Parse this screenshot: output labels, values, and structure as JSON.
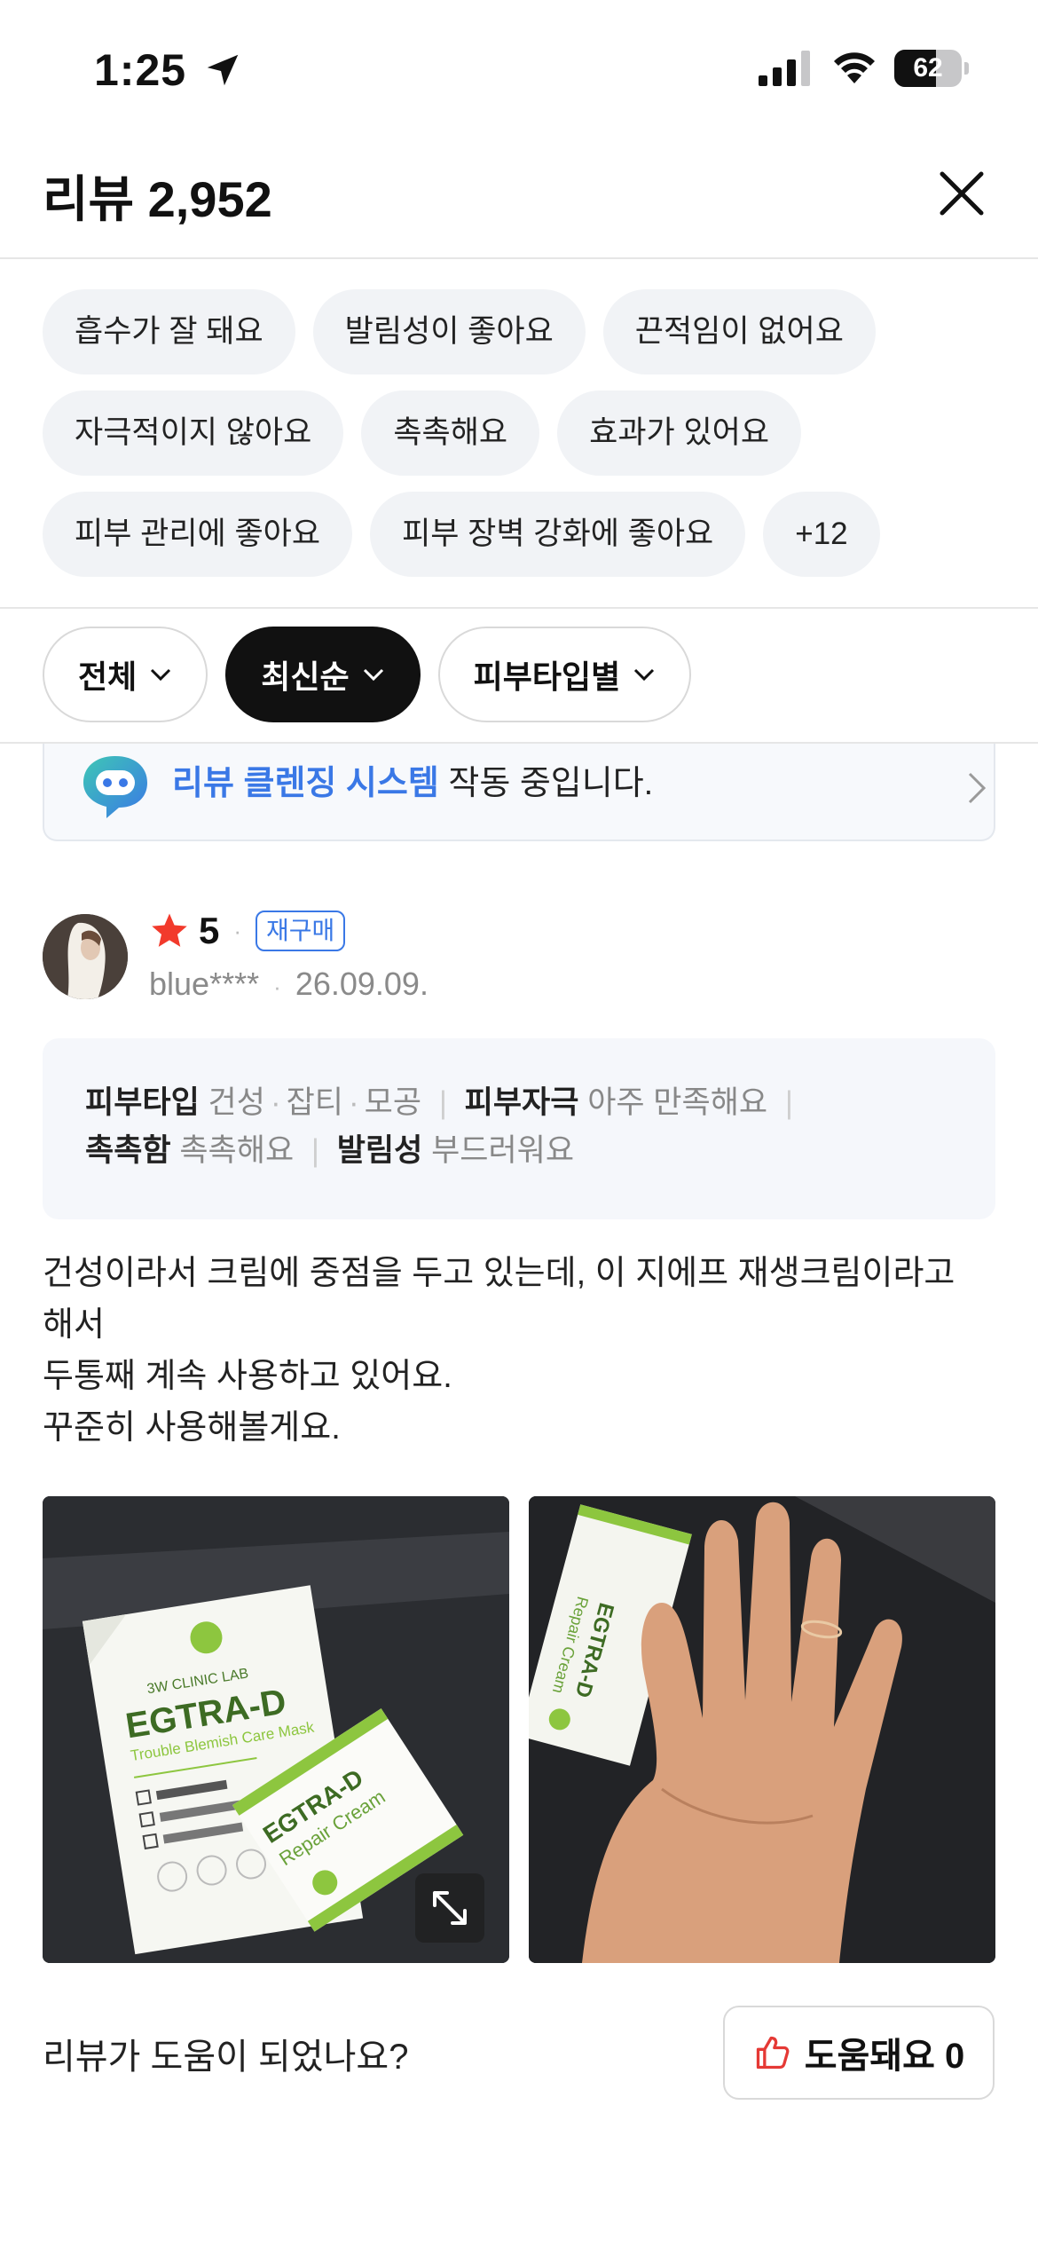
{
  "status_bar": {
    "time": "1:25",
    "battery": "62",
    "battery_level": 0.62
  },
  "header": {
    "title": "리뷰 2,952"
  },
  "tags": [
    [
      "흡수가 잘 돼요",
      "발림성이 좋아요",
      "끈적임이 없어요"
    ],
    [
      "자극적이지 않아요",
      "촉촉해요",
      "효과가 있어요"
    ],
    [
      "피부 관리에 좋아요",
      "피부 장벽 강화에 좋아요",
      "+12"
    ]
  ],
  "filters": {
    "all": "전체",
    "latest": "최신순",
    "skin_type": "피부타입별"
  },
  "banner": {
    "accent": "리뷰 클렌징 시스템",
    "rest": " 작동 중입니다."
  },
  "review": {
    "rating": "5",
    "rating_value": 5,
    "badge": "재구매",
    "user": "blue****",
    "date": "26.09.09.",
    "info": {
      "skin_type_label": "피부타입",
      "skin_types": [
        "건성",
        "잡티",
        "모공"
      ],
      "irritation_label": "피부자극",
      "irritation_value": "아주 만족해요",
      "moist_label": "촉촉함",
      "moist_value": "촉촉해요",
      "spread_label": "발림성",
      "spread_value": "부드러워요"
    },
    "text": [
      "건성이라서 크림에 중점을 두고 있는데, 이 지에프 재생크림이라고",
      "해서",
      "두통째 계속 사용하고 있어요.",
      "꾸준히 사용해볼게요."
    ],
    "photo_text": {
      "brand": "3W CLINIC LAB",
      "product": "EGTRA-D",
      "mask": "Trouble Blemish Care Mask",
      "cream": "Repair Cream"
    }
  },
  "helpful": {
    "question": "리뷰가 도움이 되었나요?",
    "label": "도움돼요 0"
  },
  "colors": {
    "accent": "#3a78e6",
    "star": "#f23a2c",
    "thumb": "#e53935"
  }
}
